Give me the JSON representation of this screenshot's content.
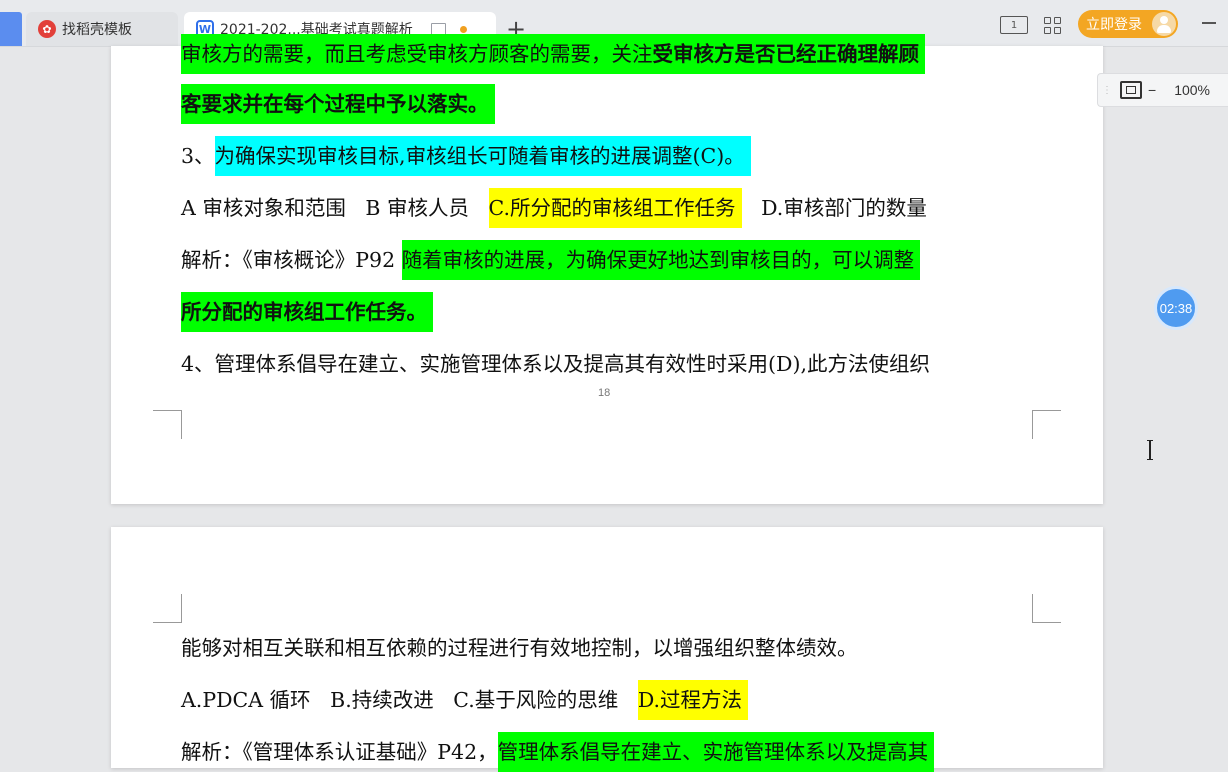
{
  "tabs": [
    {
      "label": "找稻壳模板",
      "icon": "daoke-logo-icon",
      "active": false
    },
    {
      "label": "2021-202...基础考试真题解析",
      "icon": "wps-writer-icon",
      "active": true
    }
  ],
  "toolbar": {
    "page_view_label": "1",
    "login_label": "立即登录",
    "zoom_level": "100%",
    "zoom_minus": "−"
  },
  "timer": "02:38",
  "page1": {
    "line0": {
      "a": "审核方的需要，而且考虑受审核方顾客的需要，关注",
      "b": "受审核方是否已经正确理解顾"
    },
    "line1": "客要求并在每个过程中予以落实。",
    "q3": {
      "num": "3、",
      "text": "为确保实现审核目标,审核组长可随着审核的进展调整(C)。"
    },
    "q3_options": {
      "a": "A 审核对象和范围",
      "b": "B 审核人员",
      "c": "C.所分配的审核组工作任务",
      "d": "D.审核部门的数量"
    },
    "q3_analysis": {
      "prefix": "解析：《审核概论》P92",
      "hl": "随着审核的进展，为确保更好地达到审核目的，可以调整"
    },
    "q3_analysis2": "所分配的审核组工作任务。",
    "q4": "4、管理体系倡导在建立、实施管理体系以及提高其有效性时采用(D),此方法使组织",
    "page_number": "18"
  },
  "page2": {
    "line0": "能够对相互关联和相互依赖的过程进行有效地控制，以增强组织整体绩效。",
    "q4_options": {
      "a": "A.PDCA 循环",
      "b": "B.持续改进",
      "c": "C.基于风险的思维",
      "d": "D.过程方法"
    },
    "q4_analysis": {
      "prefix": "解析：《管理体系认证基础》P42，",
      "hl": "管理体系倡导在建立、实施管理体系以及提高其"
    }
  },
  "colors": {
    "highlight_green": "#00ff00",
    "highlight_cyan": "#00ffff",
    "highlight_yellow": "#ffff00",
    "login": "#f3a623",
    "timer": "#4f9bf0"
  }
}
